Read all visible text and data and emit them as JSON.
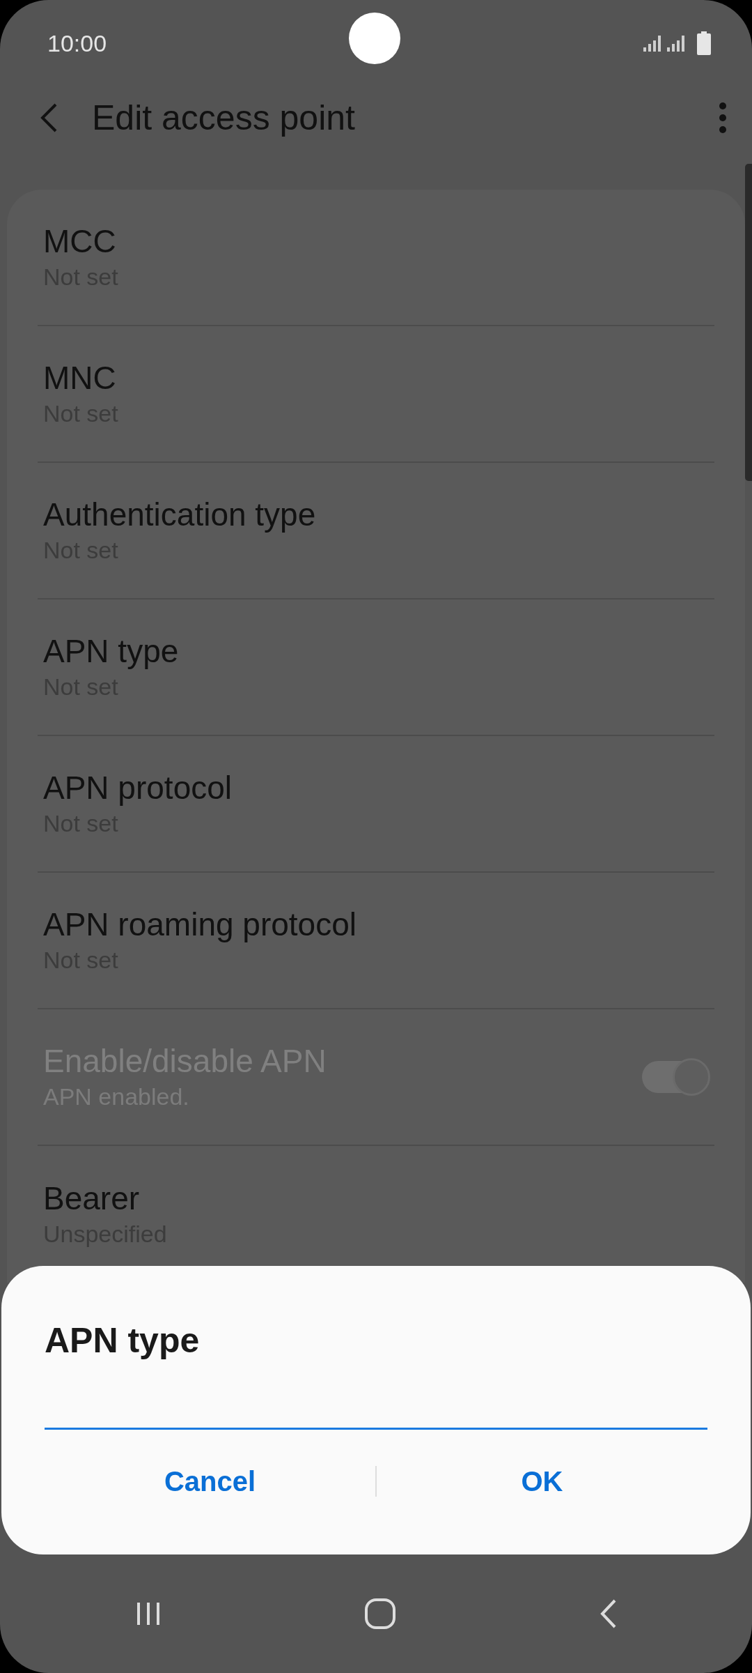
{
  "status_bar": {
    "time": "10:00"
  },
  "header": {
    "title": "Edit access point"
  },
  "settings": [
    {
      "kind": "text",
      "title": "MCC",
      "value": "Not set",
      "disabled": false
    },
    {
      "kind": "text",
      "title": "MNC",
      "value": "Not set",
      "disabled": false
    },
    {
      "kind": "text",
      "title": "Authentication type",
      "value": "Not set",
      "disabled": false
    },
    {
      "kind": "text",
      "title": "APN type",
      "value": "Not set",
      "disabled": false
    },
    {
      "kind": "text",
      "title": "APN protocol",
      "value": "Not set",
      "disabled": false
    },
    {
      "kind": "text",
      "title": "APN roaming protocol",
      "value": "Not set",
      "disabled": false
    },
    {
      "kind": "switch",
      "title": "Enable/disable APN",
      "value": "APN enabled.",
      "disabled": true,
      "on": true
    },
    {
      "kind": "text",
      "title": "Bearer",
      "value": "Unspecified",
      "disabled": false
    }
  ],
  "dialog": {
    "title": "APN type",
    "input": {
      "focused": true
    },
    "buttons": [
      "Cancel",
      "OK"
    ]
  }
}
